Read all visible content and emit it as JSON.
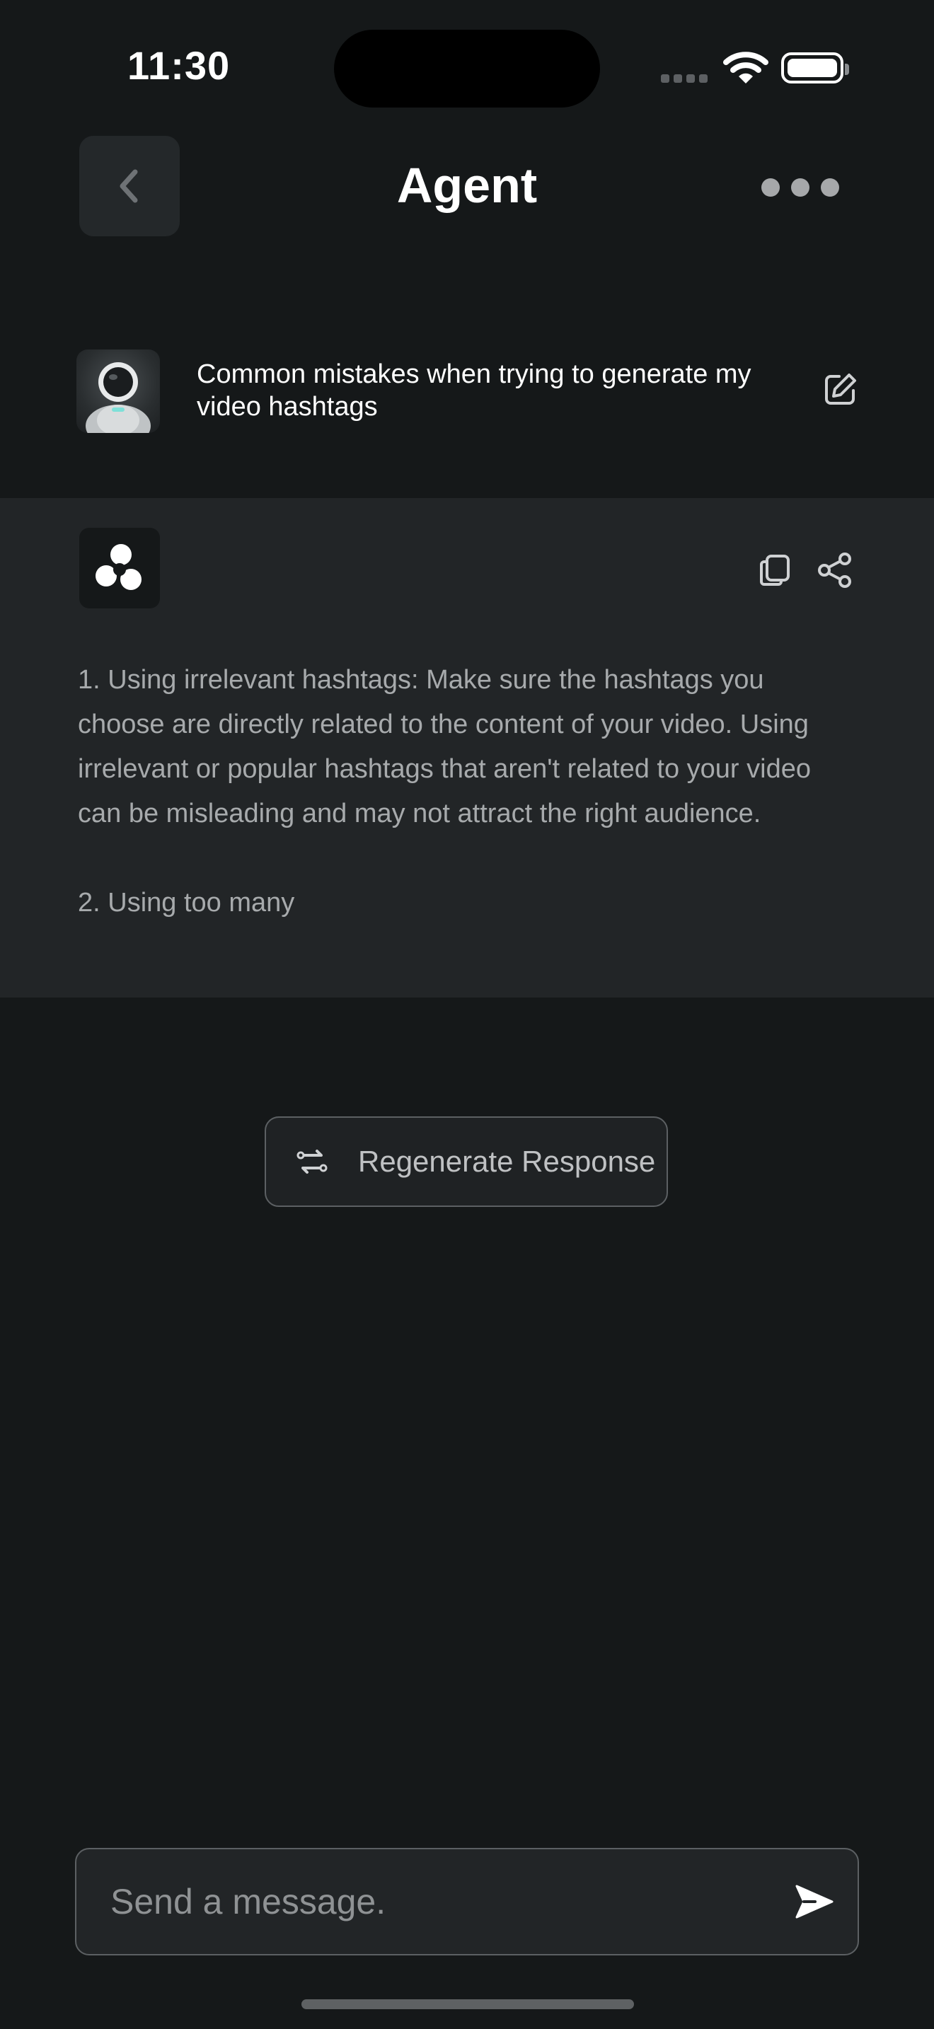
{
  "status_bar": {
    "time": "11:30",
    "icons": [
      "cellular-signal-icon",
      "wifi-icon",
      "battery-icon"
    ]
  },
  "header": {
    "back_icon": "chevron-left-icon",
    "title": "Agent",
    "more_icon": "more-horizontal-icon"
  },
  "prompt": {
    "avatar": "astronaut-avatar",
    "text": "Common mistakes when trying to generate my video hashtags",
    "edit_icon": "edit-icon"
  },
  "response": {
    "logo_icon": "agent-logo-icon",
    "actions": [
      "copy-icon",
      "share-icon"
    ],
    "paragraphs": [
      "1. Using irrelevant hashtags: Make sure the hashtags you choose are directly related to the content of your video. Using irrelevant or popular hashtags that aren't related to your video can be misleading and may not attract the right audience.",
      "2. Using too many"
    ]
  },
  "regenerate": {
    "label": "Regenerate Response",
    "icon": "regenerate-icon"
  },
  "composer": {
    "placeholder": "Send a message.",
    "value": "",
    "send_icon": "send-icon"
  },
  "colors": {
    "background": "#151819",
    "panel": "#222527",
    "text_secondary": "#a7aaac",
    "border": "#5c6063"
  }
}
